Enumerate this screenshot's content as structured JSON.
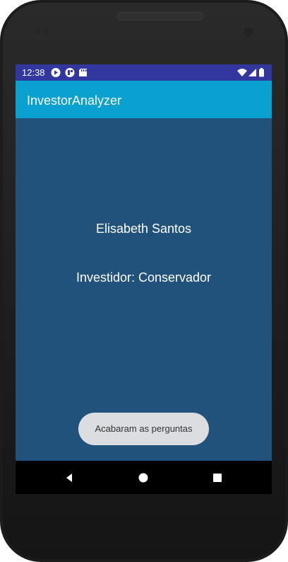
{
  "status_bar": {
    "time": "12:38",
    "left_icons": [
      "play-circle-icon",
      "tile-icon",
      "sd-card-icon"
    ],
    "right_icons": [
      "wifi-icon",
      "cell-signal-icon",
      "battery-icon"
    ]
  },
  "app_bar": {
    "title": "InvestorAnalyzer",
    "color": "#0AA0CF"
  },
  "content": {
    "name": "Elisabeth Santos",
    "investor_type": "Investidor: Conservador",
    "background": "#21527B"
  },
  "toast": {
    "message": "Acabaram as perguntas"
  },
  "nav_bar": {
    "buttons": [
      "back-icon",
      "home-icon",
      "recents-icon"
    ]
  }
}
